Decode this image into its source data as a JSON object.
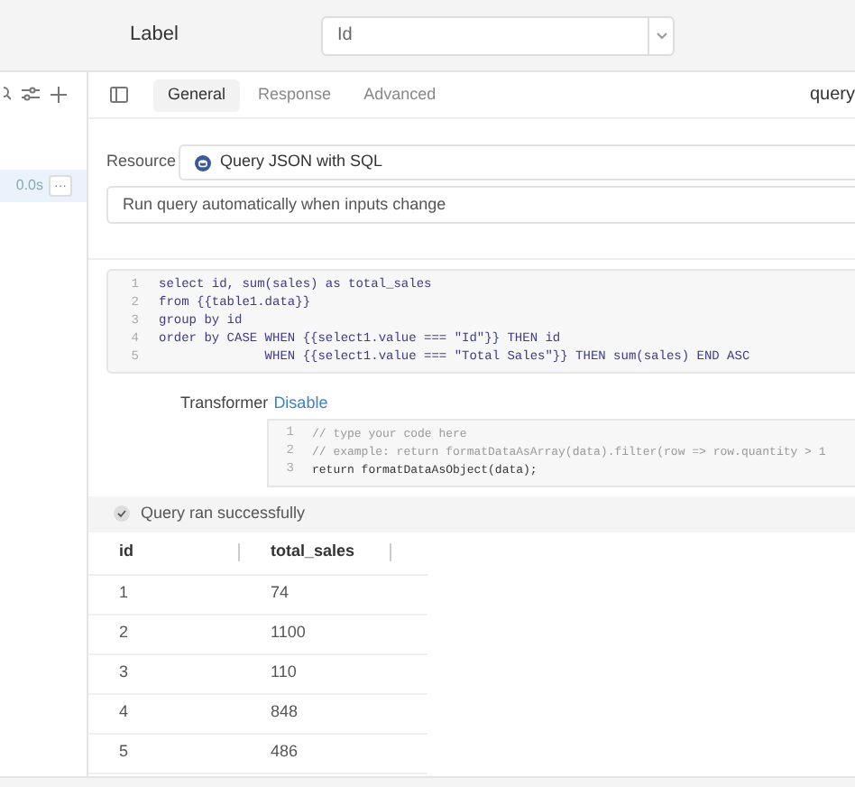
{
  "header": {
    "label": "Label",
    "select_value": "Id"
  },
  "sidebar": {
    "duration": "0.0s",
    "more": "···"
  },
  "tabs": [
    {
      "label": "General",
      "selected": true
    },
    {
      "label": "Response",
      "selected": false
    },
    {
      "label": "Advanced",
      "selected": false
    }
  ],
  "query_name": "query",
  "resource": {
    "label": "Resource",
    "value": "Query JSON with SQL"
  },
  "trigger": {
    "value": "Run query automatically when inputs change"
  },
  "sql_lines": [
    {
      "number": "1",
      "code": "select id, sum(sales) as total_sales"
    },
    {
      "number": "2",
      "code": "from {{table1.data}}"
    },
    {
      "number": "3",
      "code": "group by id"
    },
    {
      "number": "4",
      "code": "order by CASE WHEN {{select1.value === \"Id\"}} THEN id"
    },
    {
      "number": "5",
      "code": "              WHEN {{select1.value === \"Total Sales\"}} THEN sum(sales) END ASC"
    }
  ],
  "transformer": {
    "label": "Transformer",
    "action": "Disable",
    "lines": [
      {
        "number": "1",
        "code": "// type your code here"
      },
      {
        "number": "2",
        "code": "// example: return formatDataAsArray(data).filter(row => row.quantity > 1"
      },
      {
        "number": "3",
        "code": "return formatDataAsObject(data);"
      }
    ]
  },
  "status": "Query ran successfully",
  "table": {
    "columns": [
      "id",
      "total_sales"
    ],
    "rows": [
      [
        "1",
        "74"
      ],
      [
        "2",
        "1100"
      ],
      [
        "3",
        "110"
      ],
      [
        "4",
        "848"
      ],
      [
        "5",
        "486"
      ]
    ]
  }
}
